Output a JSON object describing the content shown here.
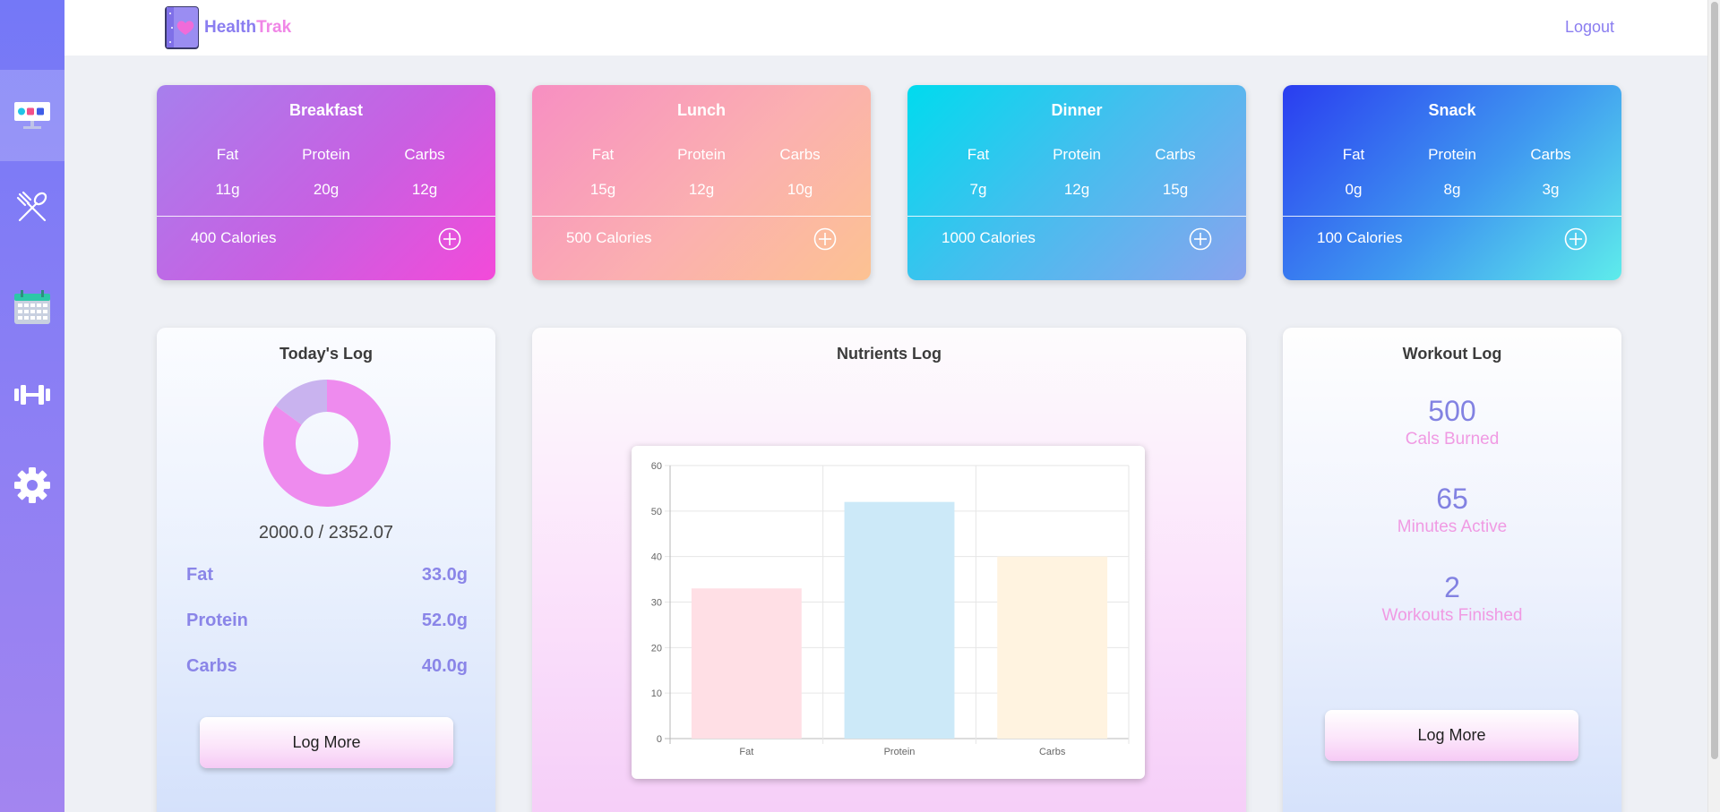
{
  "app": {
    "logo_part1": "Health",
    "logo_part2": "Trak",
    "logout": "Logout"
  },
  "sidebar": {
    "items": [
      {
        "icon": "dashboard-icon",
        "active": true
      },
      {
        "icon": "fork-spoon-icon",
        "active": false
      },
      {
        "icon": "calendar-icon",
        "active": false
      },
      {
        "icon": "dumbbell-icon",
        "active": false
      },
      {
        "icon": "gear-icon",
        "active": false
      }
    ]
  },
  "meals": [
    {
      "title": "Breakfast",
      "fat_label": "Fat",
      "protein_label": "Protein",
      "carbs_label": "Carbs",
      "fat": "11g",
      "protein": "20g",
      "carbs": "12g",
      "calories": "400 Calories"
    },
    {
      "title": "Lunch",
      "fat_label": "Fat",
      "protein_label": "Protein",
      "carbs_label": "Carbs",
      "fat": "15g",
      "protein": "12g",
      "carbs": "10g",
      "calories": "500 Calories"
    },
    {
      "title": "Dinner",
      "fat_label": "Fat",
      "protein_label": "Protein",
      "carbs_label": "Carbs",
      "fat": "7g",
      "protein": "12g",
      "carbs": "15g",
      "calories": "1000 Calories"
    },
    {
      "title": "Snack",
      "fat_label": "Fat",
      "protein_label": "Protein",
      "carbs_label": "Carbs",
      "fat": "0g",
      "protein": "8g",
      "carbs": "3g",
      "calories": "100 Calories"
    }
  ],
  "todays_log": {
    "title": "Today's Log",
    "ratio": "2000.0 / 2352.07",
    "consumed": 2000.0,
    "goal": 2352.07,
    "rows": [
      {
        "label": "Fat",
        "value": "33.0g"
      },
      {
        "label": "Protein",
        "value": "52.0g"
      },
      {
        "label": "Carbs",
        "value": "40.0g"
      }
    ],
    "button": "Log More",
    "colors": {
      "consumed": "#ee8bee",
      "remaining": "#c9b3ef"
    }
  },
  "nutrients_log": {
    "title": "Nutrients Log"
  },
  "chart_data": {
    "type": "bar",
    "categories": [
      "Fat",
      "Protein",
      "Carbs"
    ],
    "values": [
      33,
      52,
      40
    ],
    "ylim": [
      0,
      60
    ],
    "yticks": [
      "0",
      "10",
      "20",
      "30",
      "40",
      "50",
      "60"
    ],
    "grid": true,
    "colors": [
      "#ffdfe5",
      "#cce9f8",
      "#fff3e0"
    ]
  },
  "workout_log": {
    "title": "Workout Log",
    "stats": [
      {
        "value": "500",
        "label": "Cals Burned"
      },
      {
        "value": "65",
        "label": "Minutes Active"
      },
      {
        "value": "2",
        "label": "Workouts Finished"
      }
    ],
    "button": "Log More"
  }
}
